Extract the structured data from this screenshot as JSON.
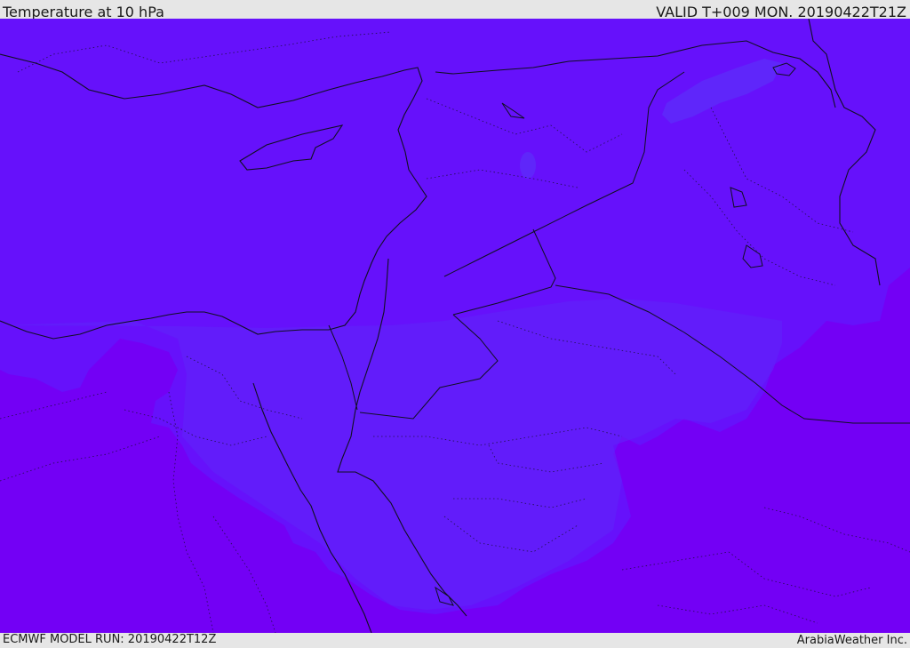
{
  "header": {
    "title": "Temperature at 10 hPa",
    "valid": "VALID T+009 MON. 20190422T21Z"
  },
  "footer": {
    "model_run": "ECMWF MODEL RUN: 20190422T12Z",
    "credit": "ArabiaWeather Inc."
  },
  "map": {
    "colors": {
      "cold_violet": "#7300f5",
      "mid_indigo": "#6611fb",
      "pale_indigo": "#5f26fa",
      "border": "#101020"
    }
  }
}
